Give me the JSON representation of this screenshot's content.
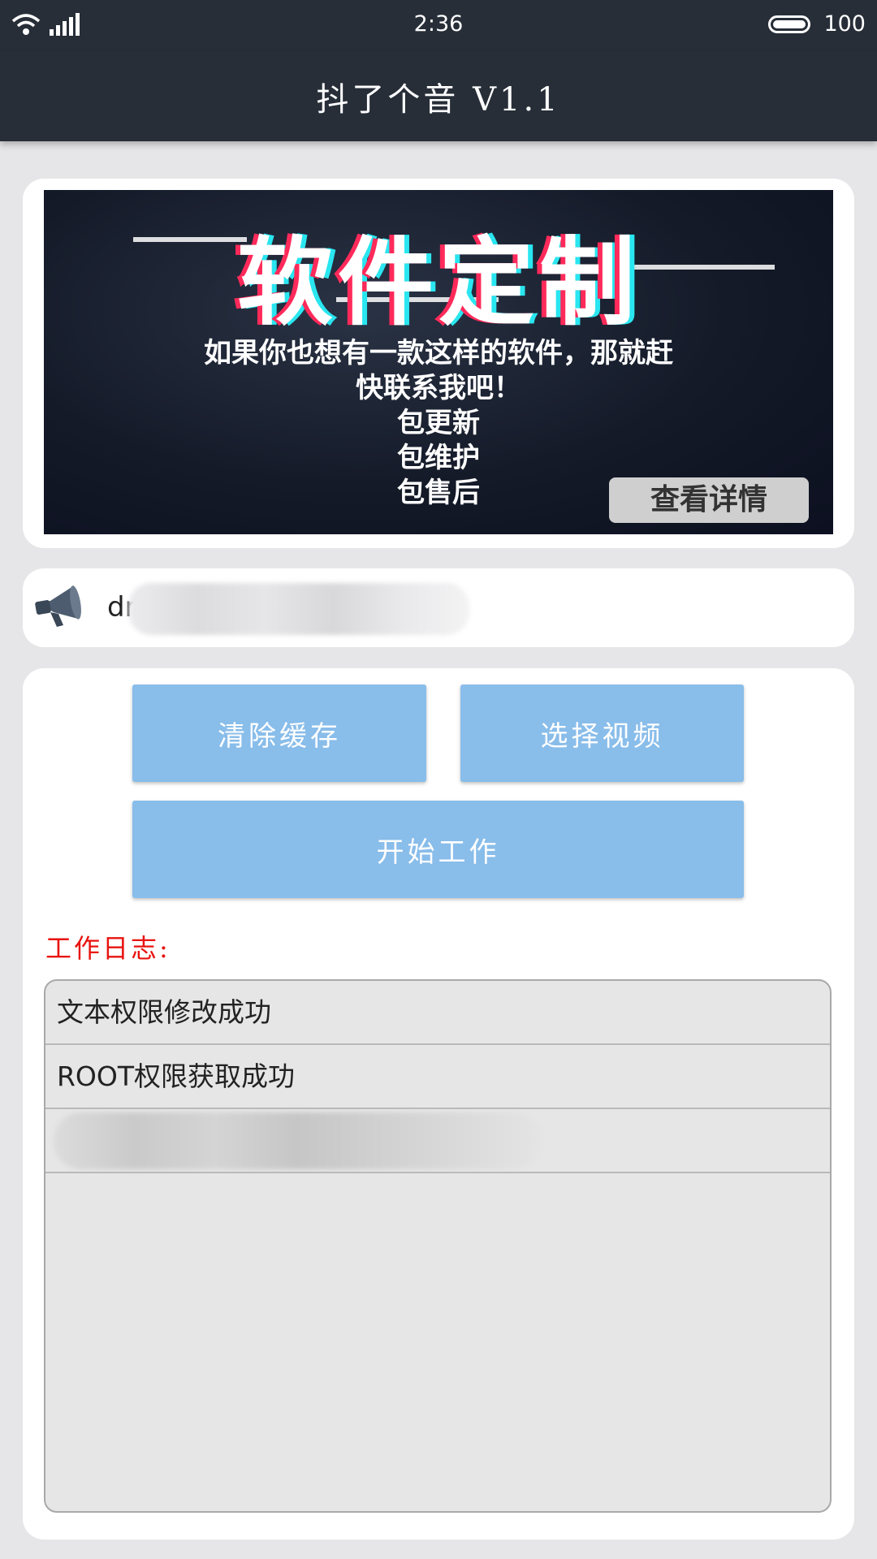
{
  "status_bar": {
    "time": "2:36",
    "battery": "100",
    "icons": [
      "wifi-icon",
      "signal-icon",
      "battery-icon"
    ]
  },
  "app": {
    "title": "抖了个音 V1.1"
  },
  "banner": {
    "title": "软件定制",
    "lines": [
      "如果你也想有一款这样的软件，那就赶",
      "快联系我吧！",
      "包更新",
      "包维护",
      "包售后"
    ],
    "button": "查看详情"
  },
  "notice": {
    "icon": "megaphone-icon",
    "text": "drinks"
  },
  "buttons": {
    "clear_cache": "清除缓存",
    "select_video": "选择视频",
    "start_work": "开始工作"
  },
  "log": {
    "label": "工作日志:",
    "entries": [
      "文本权限修改成功",
      "ROOT权限获取成功",
      ""
    ]
  },
  "colors": {
    "header_bg": "#272e38",
    "button_bg": "#89bdea",
    "log_label": "#e8130f",
    "page_bg": "#e6e6e8"
  }
}
